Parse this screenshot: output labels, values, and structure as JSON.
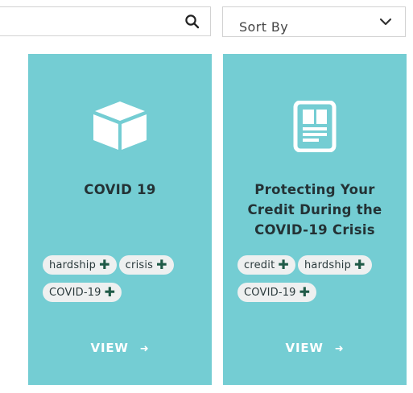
{
  "search": {
    "placeholder": ""
  },
  "sort": {
    "label": "Sort By"
  },
  "cards": [
    {
      "title": "COVID 19",
      "icon": "box-icon",
      "tags": [
        "hardship",
        "crisis",
        "COVID-19"
      ],
      "view_label": "VIEW"
    },
    {
      "title": "Protecting Your Credit During the COVID-19 Crisis",
      "icon": "document-icon",
      "tags": [
        "credit",
        "hardship",
        "COVID-19"
      ],
      "view_label": "VIEW"
    }
  ],
  "colors": {
    "card_bg": "#74cdd3",
    "tag_bg": "#eef0f0",
    "plus": "#1f5a47",
    "title": "#243235"
  }
}
